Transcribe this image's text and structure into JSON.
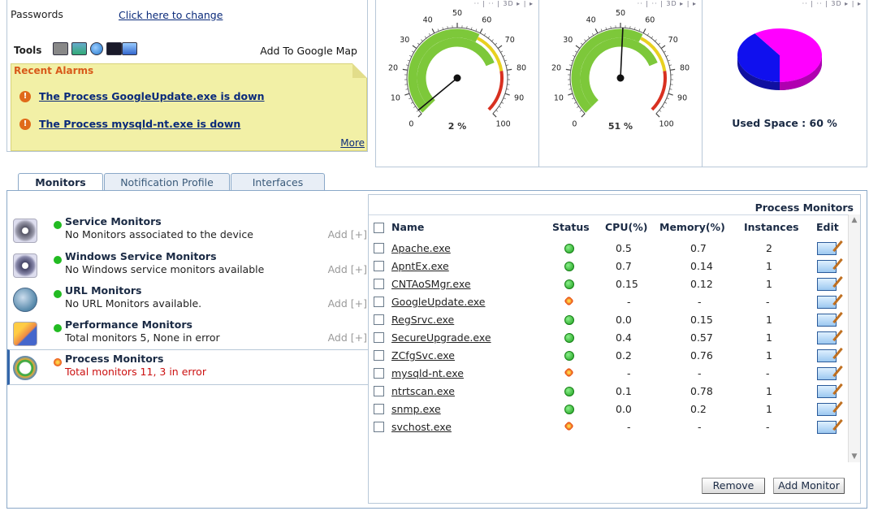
{
  "info": {
    "passwords_label": "Passwords",
    "passwords_link": "Click here to change",
    "tools_label": "Tools",
    "google_map_link": "Add To Google Map",
    "recent_alarms_title": "Recent Alarms",
    "alarms": [
      {
        "text": "The Process GoogleUpdate.exe is down"
      },
      {
        "text": "The Process mysqld-nt.exe is down"
      }
    ],
    "more_link": "More"
  },
  "gauges": {
    "toolbar_text": "·· | ·· | 3D ▸ | ▸",
    "ticks": [
      "0",
      "10",
      "20",
      "30",
      "40",
      "50",
      "60",
      "70",
      "80",
      "90",
      "100"
    ],
    "cpu": {
      "value": 2,
      "label": "2 %"
    },
    "memory": {
      "value": 51,
      "label": "51 %"
    },
    "disk": {
      "used_percent": 60,
      "label": "Used Space : 60 %",
      "used_color": "#ff00ff",
      "free_color": "#1010ee"
    }
  },
  "tabs": [
    {
      "label": "Monitors",
      "active": true
    },
    {
      "label": "Notification Profile",
      "active": false
    },
    {
      "label": "Interfaces",
      "active": false
    }
  ],
  "monitor_categories": [
    {
      "name": "Service Monitors",
      "desc": "No Monitors associated to the device",
      "add": "Add [+]",
      "status": "up",
      "icon": "gear-icon"
    },
    {
      "name": "Windows Service Monitors",
      "desc": "No Windows service monitors available",
      "add": "Add [+]",
      "status": "up",
      "icon": "windows-gear-icon"
    },
    {
      "name": "URL Monitors",
      "desc": "No URL Monitors available.",
      "add": "Add [+]",
      "status": "up",
      "icon": "www-globe-icon"
    },
    {
      "name": "Performance Monitors",
      "desc": "Total monitors 5, None in error",
      "add": "Add [+]",
      "status": "up",
      "icon": "performance-icon"
    },
    {
      "name": "Process Monitors",
      "desc": "Total monitors 11, 3 in error",
      "add": "",
      "status": "down",
      "icon": "process-cycle-icon"
    }
  ],
  "process_panel": {
    "title": "Process Monitors",
    "columns": [
      "Name",
      "Status",
      "CPU(%)",
      "Memory(%)",
      "Instances",
      "Edit"
    ],
    "rows": [
      {
        "name": "Apache.exe",
        "status": "up",
        "cpu": "0.5",
        "memory": "0.7",
        "instances": "2"
      },
      {
        "name": "ApntEx.exe",
        "status": "up",
        "cpu": "0.7",
        "memory": "0.14",
        "instances": "1"
      },
      {
        "name": "CNTAoSMgr.exe",
        "status": "up",
        "cpu": "0.15",
        "memory": "0.12",
        "instances": "1"
      },
      {
        "name": "GoogleUpdate.exe",
        "status": "down",
        "cpu": "-",
        "memory": "-",
        "instances": "-"
      },
      {
        "name": "RegSrvc.exe",
        "status": "up",
        "cpu": "0.0",
        "memory": "0.15",
        "instances": "1"
      },
      {
        "name": "SecureUpgrade.exe",
        "status": "up",
        "cpu": "0.4",
        "memory": "0.57",
        "instances": "1"
      },
      {
        "name": "ZCfgSvc.exe",
        "status": "up",
        "cpu": "0.2",
        "memory": "0.76",
        "instances": "1"
      },
      {
        "name": "mysqld-nt.exe",
        "status": "down",
        "cpu": "-",
        "memory": "-",
        "instances": "-"
      },
      {
        "name": "ntrtscan.exe",
        "status": "up",
        "cpu": "0.1",
        "memory": "0.78",
        "instances": "1"
      },
      {
        "name": "snmp.exe",
        "status": "up",
        "cpu": "0.0",
        "memory": "0.2",
        "instances": "1"
      },
      {
        "name": "svchost.exe",
        "status": "down",
        "cpu": "-",
        "memory": "-",
        "instances": "-"
      }
    ],
    "remove_label": "Remove",
    "add_monitor_label": "Add Monitor"
  }
}
